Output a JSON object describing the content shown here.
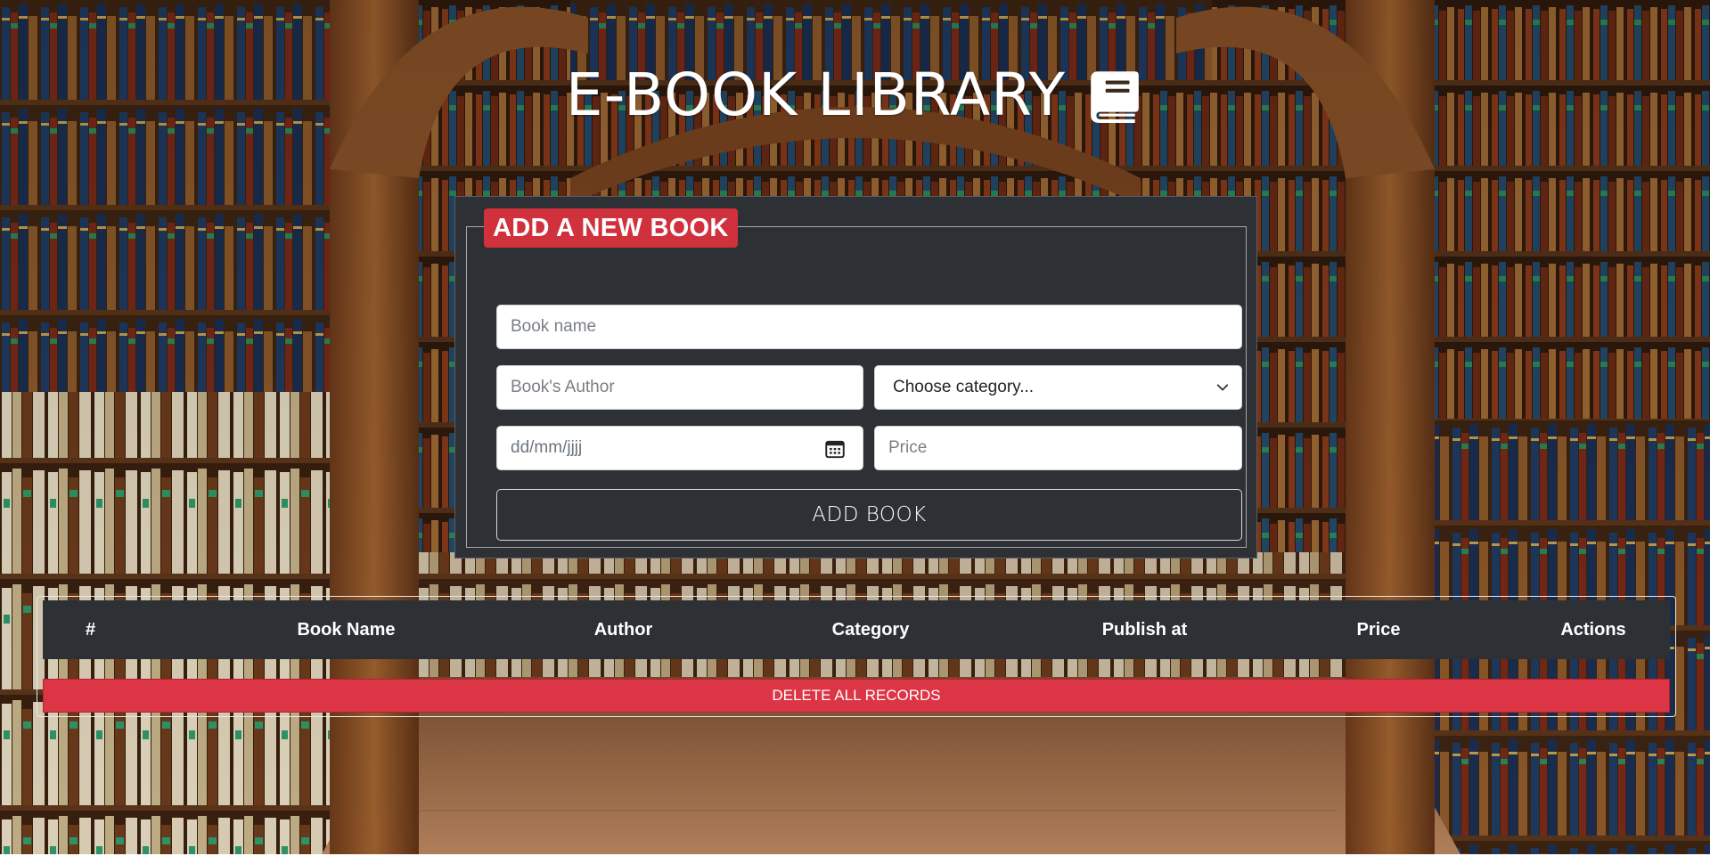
{
  "app": {
    "title": "E-BOOK LIBRARY",
    "title_icon": "book-icon"
  },
  "form": {
    "legend": "ADD A NEW BOOK",
    "book_name_placeholder": "Book name",
    "author_placeholder": "Book's Author",
    "category_selected": "Choose category...",
    "date_placeholder": "dd/mm/jjjj",
    "price_placeholder": "Price",
    "submit_label": "ADD BOOK"
  },
  "table": {
    "columns": [
      "#",
      "Book Name",
      "Author",
      "Category",
      "Publish at",
      "Price",
      "Actions"
    ],
    "rows": [],
    "delete_all_label": "DELETE ALL RECORDS"
  },
  "colors": {
    "legend_bg": "#d0313c",
    "panel_bg": "#2d3035",
    "delete_bg": "#dc3545"
  }
}
